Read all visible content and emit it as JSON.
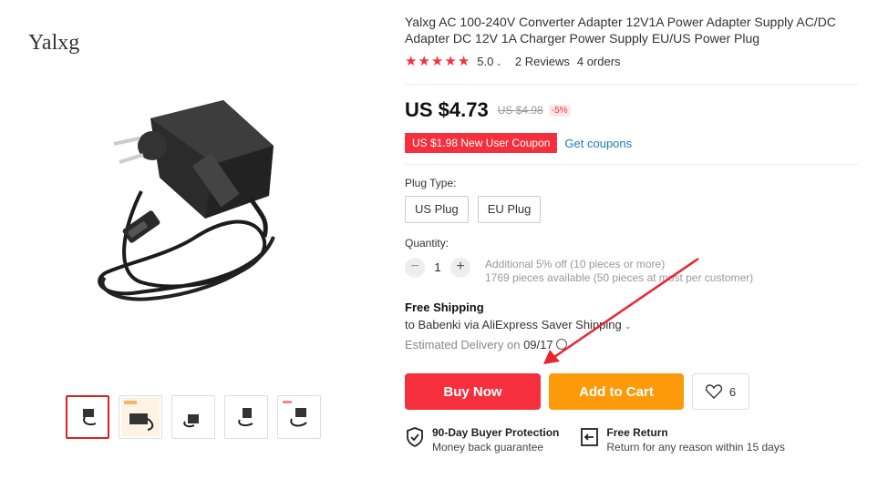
{
  "store": {
    "brand": "Yalxg"
  },
  "product": {
    "title": "Yalxg AC 100-240V Converter Adapter 12V1A Power Adapter Supply AC/DC Adapter DC 12V 1A Charger Power Supply EU/US Power Plug",
    "rating": "5.0",
    "reviews": "2 Reviews",
    "orders": "4 orders",
    "stars": 5
  },
  "price": {
    "current": "US $4.73",
    "original": "US $4.98",
    "discount": "-5%",
    "coupon": "US $1.98 New User Coupon",
    "get_coupons": "Get coupons"
  },
  "options": {
    "plug_label": "Plug Type:",
    "plugs": [
      "US Plug",
      "EU Plug"
    ]
  },
  "quantity": {
    "label": "Quantity:",
    "value": "1",
    "minus": "−",
    "plus": "+",
    "note1": "Additional 5% off (10 pieces or more)",
    "note2": "1769 pieces available (50 pieces at most per customer)"
  },
  "shipping": {
    "title": "Free Shipping",
    "to": "to Babenki via AliExpress Saver Shipping",
    "delivery_label": "Estimated Delivery on",
    "delivery_date": "09/17"
  },
  "actions": {
    "buy_now": "Buy Now",
    "add_to_cart": "Add to Cart",
    "wishlist_count": "6"
  },
  "guarantees": [
    {
      "title": "90-Day Buyer Protection",
      "subtitle": "Money back guarantee",
      "icon": "shield-check-icon"
    },
    {
      "title": "Free Return",
      "subtitle": "Return for any reason within 15 days",
      "icon": "return-icon"
    }
  ],
  "colors": {
    "accent_red": "#f5303c",
    "accent_orange": "#fd9a0a",
    "link_blue": "#1a7bb5"
  }
}
